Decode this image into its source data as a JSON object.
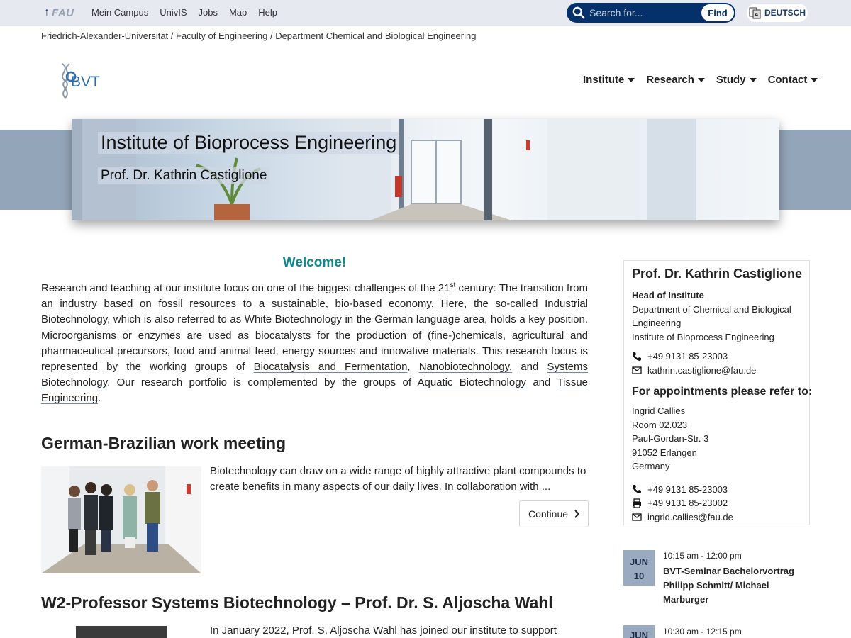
{
  "topbar": {
    "fau_label": "FAU",
    "nav": [
      "Mein Campus",
      "UnivIS",
      "Jobs",
      "Map",
      "Help"
    ],
    "search_placeholder": "Search for...",
    "find_label": "Find",
    "language_label": "DEUTSCH"
  },
  "breadcrumb": "Friedrich-Alexander-Universität / Faculty of Engineering / Department Chemical and Biological Engineering",
  "logo_text": "BVT",
  "mainnav": [
    "Institute",
    "Research",
    "Study",
    "Contact"
  ],
  "banner": {
    "title": "Institute of Bioprocess Engineering",
    "subtitle": "Prof. Dr. Kathrin Castiglione"
  },
  "welcome": {
    "heading": "Welcome!",
    "p1": "Research and teaching at our institute focus on one of the biggest challenges of the 21",
    "sup": "st",
    "p2": " century: The transition from an industry based on fossil resources to a sustainable, bio-based economy. Here, the so-called Industrial Biotechnology, which is also referred to as White Biotechnology in the German language area, holds a key position. Microorganisms or enzymes are used as biocatalysts for the production of (fine-)chemicals, agricultural and pharma­ceutical precursors, food and animal feed, energy sources and innovative materials. This research focus is repre­sented by the working groups of ",
    "link1": "Biocatalysis and Fermentation",
    "sep1": ", ",
    "link2": "Nanobiotechnology,",
    "sep2": " and ",
    "link3": "Systems Biotechnology",
    "p3": ". Our research portfolio is complemented by the groups of ",
    "link4": "Aquatic Biotechnology",
    "sep3": " and ",
    "link5": "Tissue Engineering",
    "p4": "."
  },
  "news": [
    {
      "title": "German-Brazilian work meeting",
      "text": "Biotechnology can draw on a wide range of highly attractive plant compounds to create benefits in many aspects of our daily lives. In collaboration with ...",
      "continue_label": "Continue"
    },
    {
      "title": "W2-Professor Systems Biotechnology – Prof. Dr. S. Aljoscha Wahl",
      "text": "In January 2022, Prof. S. Aljoscha Wahl has joined our institute to support"
    }
  ],
  "contact": {
    "name": "Prof. Dr. Kathrin Castiglione",
    "role": "Head of Institute",
    "dept": "Department of Chemical and Biological Engineering",
    "institute": "Institute of Bioprocess Engineering",
    "phone": "+49 9131 85-23003",
    "email": "kathrin.castiglione@fau.de",
    "appointments_heading": "For appointments please refer to:",
    "appt_name": "Ingrid Callies",
    "appt_room": "Room 02.023",
    "appt_street": "Paul-Gordan-Str. 3",
    "appt_city": "91052 Erlangen",
    "appt_country": "Germany",
    "appt_phone": "+49 9131 85-23003",
    "appt_fax": "+49 9131 85-23002",
    "appt_email": "ingrid.callies@fau.de"
  },
  "events": [
    {
      "month": "JUN",
      "day": "10",
      "time": "10:15 am - 12:00 pm",
      "title": "BVT-Seminar Bachelorvortrag Philipp Schmitt/ Michael Marburger"
    },
    {
      "month": "JUN",
      "time": "10:30 am - 12:15 pm"
    }
  ],
  "colors": {
    "fau_blue": "#04316a",
    "welcome_teal": "#0d8a8a",
    "banner_band": "#93a5b8",
    "event_badge": "#9aaac0"
  }
}
